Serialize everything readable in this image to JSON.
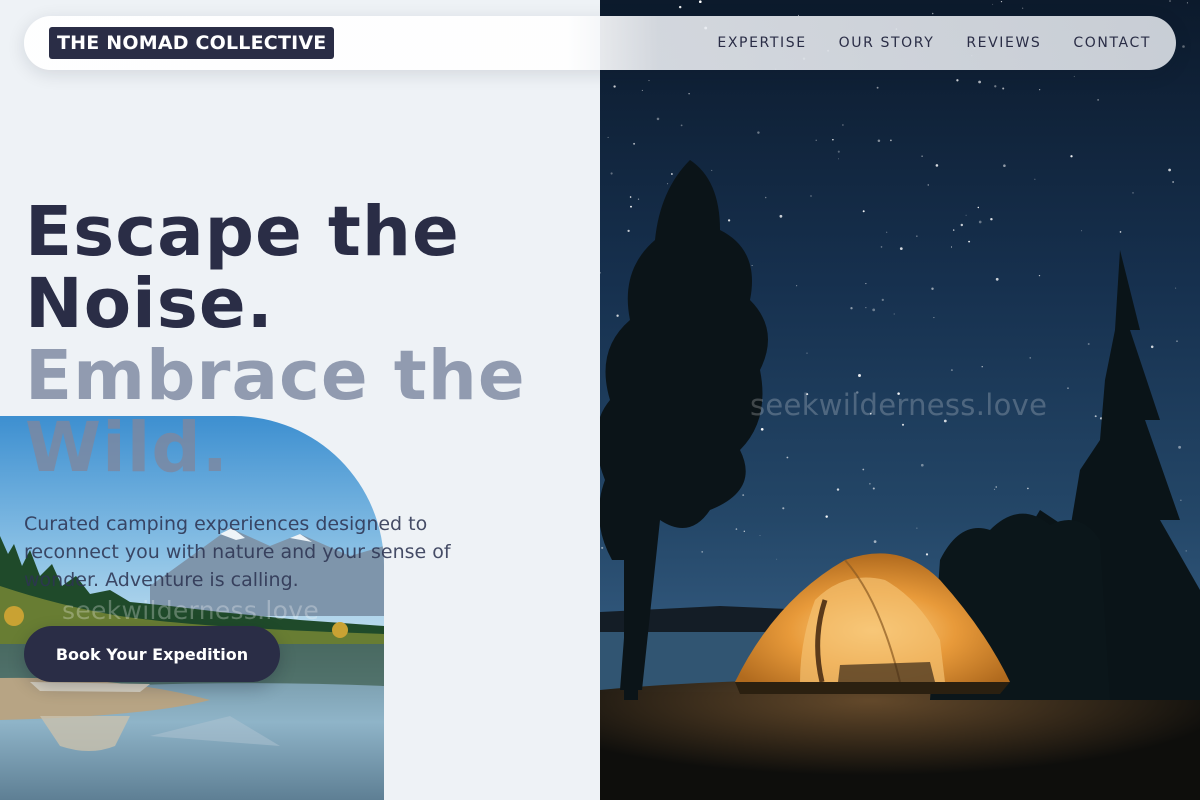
{
  "brand": {
    "name": "THE NOMAD COLLECTIVE"
  },
  "nav": {
    "links": [
      {
        "label": "EXPERTISE"
      },
      {
        "label": "OUR STORY"
      },
      {
        "label": "REVIEWS"
      },
      {
        "label": "CONTACT"
      }
    ]
  },
  "hero": {
    "headline_line1": "Escape the",
    "headline_line2": "Noise.",
    "headline_line3": "Embrace the",
    "headline_line4": "Wild.",
    "subtext": "Curated camping experiences designed to reconnect you with nature and your sense of wonder. Adventure is calling.",
    "cta_label": "Book Your Expedition"
  },
  "watermarks": {
    "right": "seekwilderness.love",
    "left": "seekwilderness.love"
  },
  "colors": {
    "brand_dark": "#2a2d46",
    "headline_muted": "#7d88a0",
    "page_bg": "#eef2f6",
    "tent_glow": "#e8a040"
  }
}
